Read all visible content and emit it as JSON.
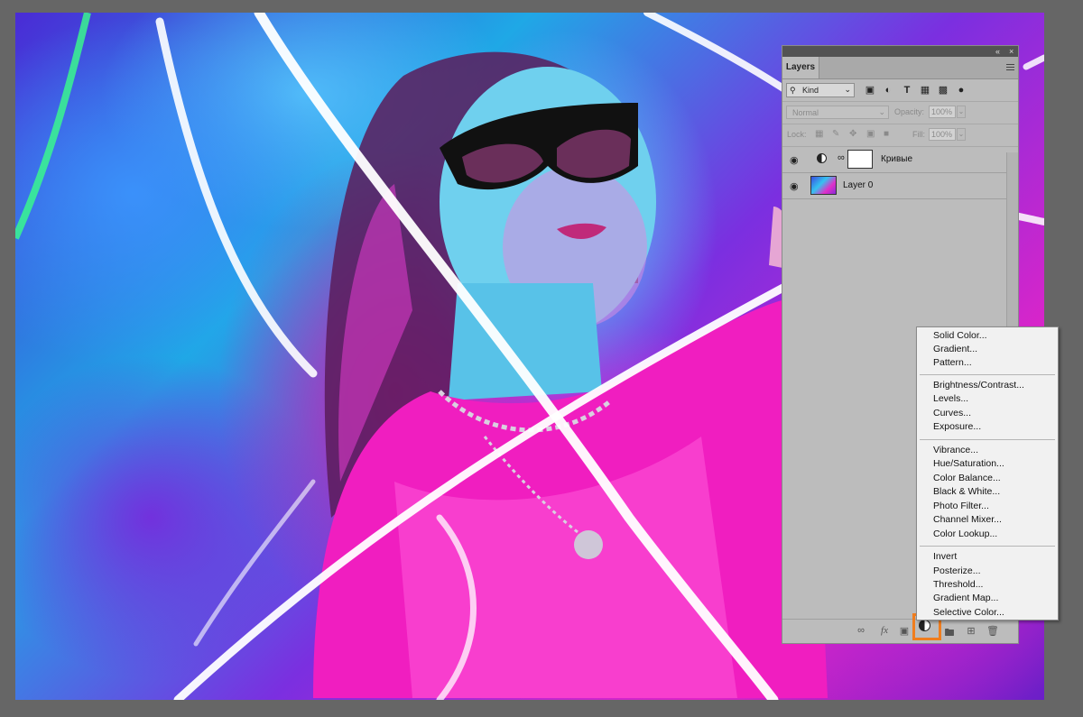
{
  "panel": {
    "tab_label": "Layers",
    "collapse_glyph": "«",
    "close_glyph": "×",
    "filter": {
      "kind_label": "Kind"
    },
    "blend_mode": "Normal",
    "opacity_label": "Opacity:",
    "opacity_value": "100%",
    "lock_label": "Lock:",
    "fill_label": "Fill:",
    "fill_value": "100%",
    "layers": [
      {
        "name": "Кривые",
        "visible": true
      },
      {
        "name": "Layer 0",
        "visible": true
      }
    ],
    "footer_icons": [
      "link-layers-icon",
      "fx-icon",
      "add-mask-icon",
      "adjustment-layer-icon",
      "new-group-icon",
      "new-layer-icon",
      "delete-icon"
    ],
    "fx_label": "fx"
  },
  "adjustment_menu": {
    "items": [
      "Solid Color...",
      "Gradient...",
      "Pattern...",
      "Brightness/Contrast...",
      "Levels...",
      "Curves...",
      "Exposure...",
      "Vibrance...",
      "Hue/Saturation...",
      "Color Balance...",
      "Black & White...",
      "Photo Filter...",
      "Channel Mixer...",
      "Color Lookup...",
      "Invert",
      "Posterize...",
      "Threshold...",
      "Gradient Map...",
      "Selective Color..."
    ]
  },
  "colors": {
    "highlight": "#f07d1e",
    "panel_bg": "#bcbcbc",
    "workspace_bg": "#666666"
  }
}
